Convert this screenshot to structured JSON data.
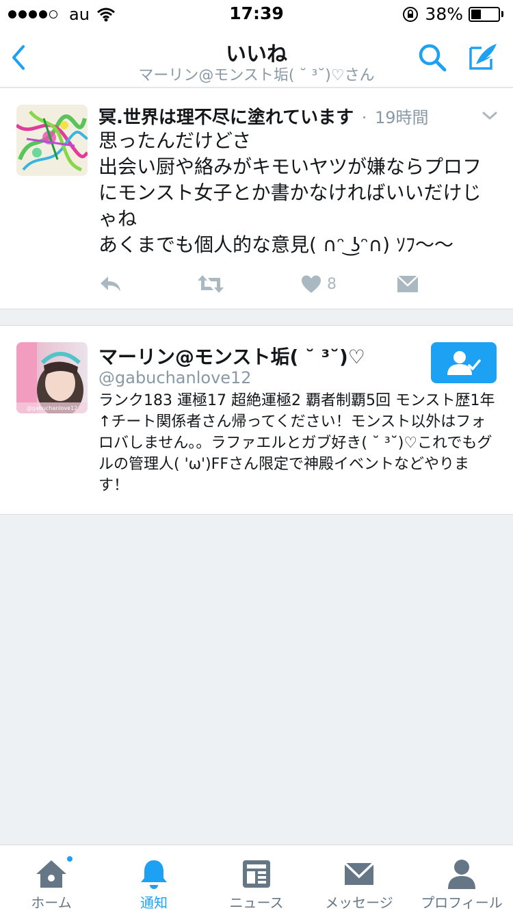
{
  "status_bar": {
    "carrier": "au",
    "time": "17:39",
    "battery_percent_label": "38%",
    "battery_level": 0.38
  },
  "nav": {
    "title": "いいね",
    "subtitle": "マーリン@モンスト垢( ˘ ³˘)♡さん",
    "back_icon": "chevron-left-icon",
    "search_icon": "search-icon",
    "compose_icon": "compose-icon"
  },
  "tweet": {
    "author": "冥.世界は理不尽に塗れています",
    "separator": " · ",
    "time": "19時間",
    "lines": [
      "思ったんだけどさ",
      "出会い厨や絡みがキモいヤツが嫌ならプロフにモンスト女子とか書かなければいいだけじゃね",
      "あくまでも個人的な意見( ∩ᵔ ͜ʖᵔ∩) ｿﾌ〜〜"
    ],
    "like_count": "8"
  },
  "user": {
    "name": "マーリン@モンスト垢( ˘ ³˘)♡",
    "handle": "@gabuchanlove12",
    "bio": "ランク183 運極17 超絶運極2 覇者制覇5回 モンスト歴1年↑チート関係者さん帰ってください！モンスト以外はフォロバしません。。ラファエルとガブ好き( ˘ ³˘)♡これでもグルの管理人( 'ω')FFさん限定で神殿イベントなどやります！",
    "avatar_caption": "@gabuchanlove12",
    "follow_state": "following"
  },
  "tabs": [
    {
      "label": "ホーム",
      "icon": "home-icon",
      "active": false,
      "badge": true
    },
    {
      "label": "通知",
      "icon": "bell-icon",
      "active": true,
      "badge": false
    },
    {
      "label": "ニュース",
      "icon": "news-icon",
      "active": false,
      "badge": false
    },
    {
      "label": "メッセージ",
      "icon": "envelope-icon",
      "active": false,
      "badge": false
    },
    {
      "label": "プロフィール",
      "icon": "person-icon",
      "active": false,
      "badge": false
    }
  ],
  "colors": {
    "accent": "#1da1f2",
    "muted": "#8899a6",
    "action_gray": "#aab8c2",
    "background": "#eef1f4"
  }
}
